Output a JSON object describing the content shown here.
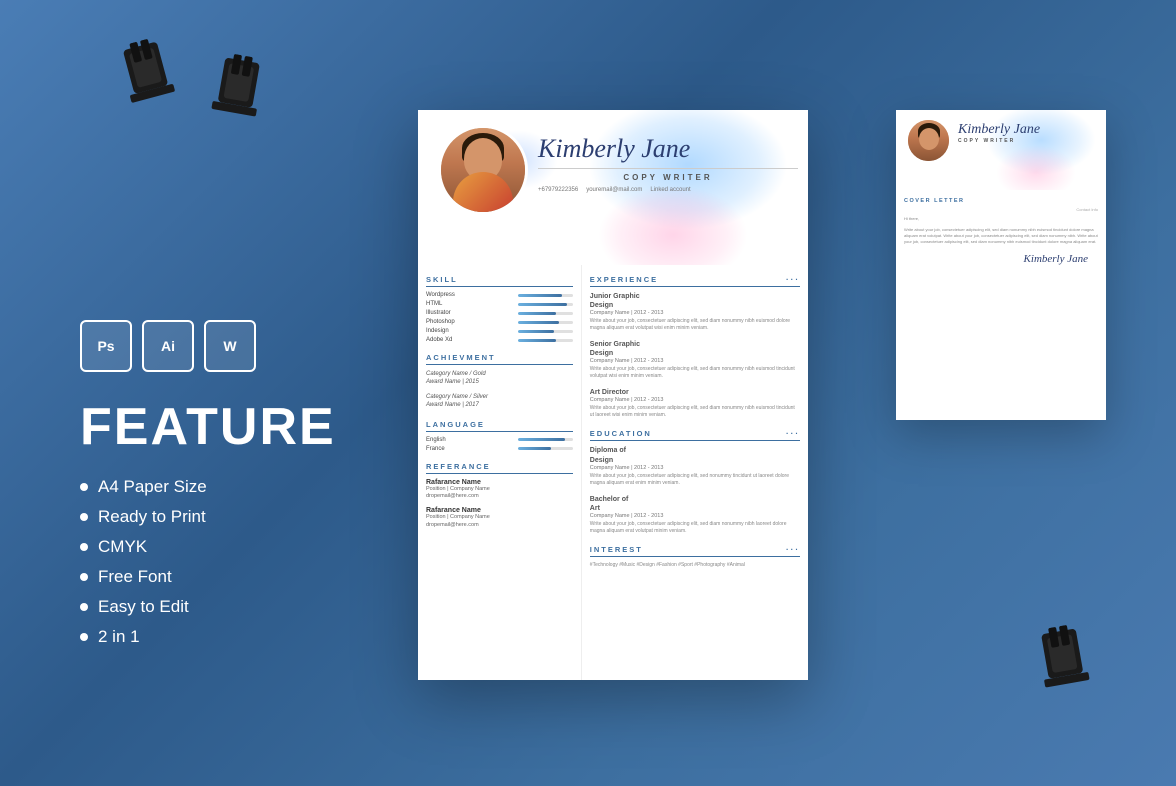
{
  "page": {
    "background_color": "#3d6fa0"
  },
  "software_icons": [
    {
      "label": "Ps",
      "name": "photoshop"
    },
    {
      "label": "Ai",
      "name": "illustrator"
    },
    {
      "label": "W",
      "name": "word"
    }
  ],
  "feature_section": {
    "title": "FEATURE",
    "list": [
      "A4 Paper Size",
      "Ready to Print",
      "CMYK",
      "Free Font",
      "Easy to Edit",
      "2 in 1"
    ]
  },
  "resume": {
    "name": "Kimberly Jane",
    "title": "COPY WRITER",
    "phone": "+67979222356",
    "email": "youremail@mail.com",
    "social": "Linked account",
    "skills": [
      {
        "name": "Wordpress",
        "level": 80
      },
      {
        "name": "HTML",
        "level": 90
      },
      {
        "name": "Illustrator",
        "level": 70
      },
      {
        "name": "Photoshop",
        "level": 75
      },
      {
        "name": "Indesign",
        "level": 65
      },
      {
        "name": "Adobe Xd",
        "level": 70
      }
    ],
    "achievements": [
      {
        "cat": "Category Name / Gold",
        "award": "Award Name | 2015"
      },
      {
        "cat": "Category Name / Silver",
        "award": "Award Name | 2017"
      }
    ],
    "languages": [
      {
        "name": "English",
        "level": 85
      },
      {
        "name": "France",
        "level": 60
      }
    ],
    "references": [
      {
        "name": "Rafarance Name",
        "position": "Position | Company Name",
        "email": "dropemail@here.com"
      },
      {
        "name": "Rafarance Name",
        "position": "Position | Company Name",
        "email": "dropemail@here.com"
      }
    ],
    "experience": [
      {
        "role": "Junior Graphic Design",
        "company": "Company Name | 2012 - 2013",
        "desc": "Write about your job, consectetuer adipiscing elit, sed diam nonummy nibh euismod dolore magna aliquam erat volutpat wisi enim minim veniam."
      },
      {
        "role": "Senior Graphic Design",
        "company": "Company Name | 2012 - 2013",
        "desc": "Write about your job, consectetuer adipiscing elit, sed diam nonummy nibh euismod tincidunt volutpat wisi enim minim veniam."
      },
      {
        "role": "Art Director",
        "company": "Company Name | 2012 - 2013",
        "desc": "Write about your job, consectetuer adipiscing elit, sed diam nonummy nibh euismod tincidunt ut laoreet wisi enim minim veniam."
      }
    ],
    "education": [
      {
        "degree": "Diploma of Design",
        "company": "Company Name | 2012 - 2013",
        "desc": "Write about your job, consectetuer adipiscing elit, sed nonummy tincidunt ut laoreet dolore magna aliquam erat enim minim veniam."
      },
      {
        "degree": "Bachelor of Art",
        "company": "Company Name | 2012 - 2013",
        "desc": "Write about your job, consectetuer adipiscing elit, sed diam nonummy nibh laoreet dolore magna aliquam erat volutpat minim veniam."
      }
    ],
    "interests": "#Technology #Music #Design #Fashion #Sport #Photography #Animal"
  },
  "cover_letter": {
    "name": "Kimberly Jane",
    "title": "COPY WRITER",
    "section": "COVER LETTER",
    "contact_info": "Contact Info",
    "greeting": "Hi there,",
    "body": "Write about your job, consectetuer adipiscing elit, sed diam nonummy nibh euismod tincidunt dolore magna aliquam erat volutpat. Write about your job, consectetuer adipiscing elit, sed diam nonummy nibh. Write about your job, consectetuer adipiscing elit, sed diam nonummy nibh euismod tincidunt dolore magna aliquam erat.",
    "signature": "Kimberly Jane"
  }
}
